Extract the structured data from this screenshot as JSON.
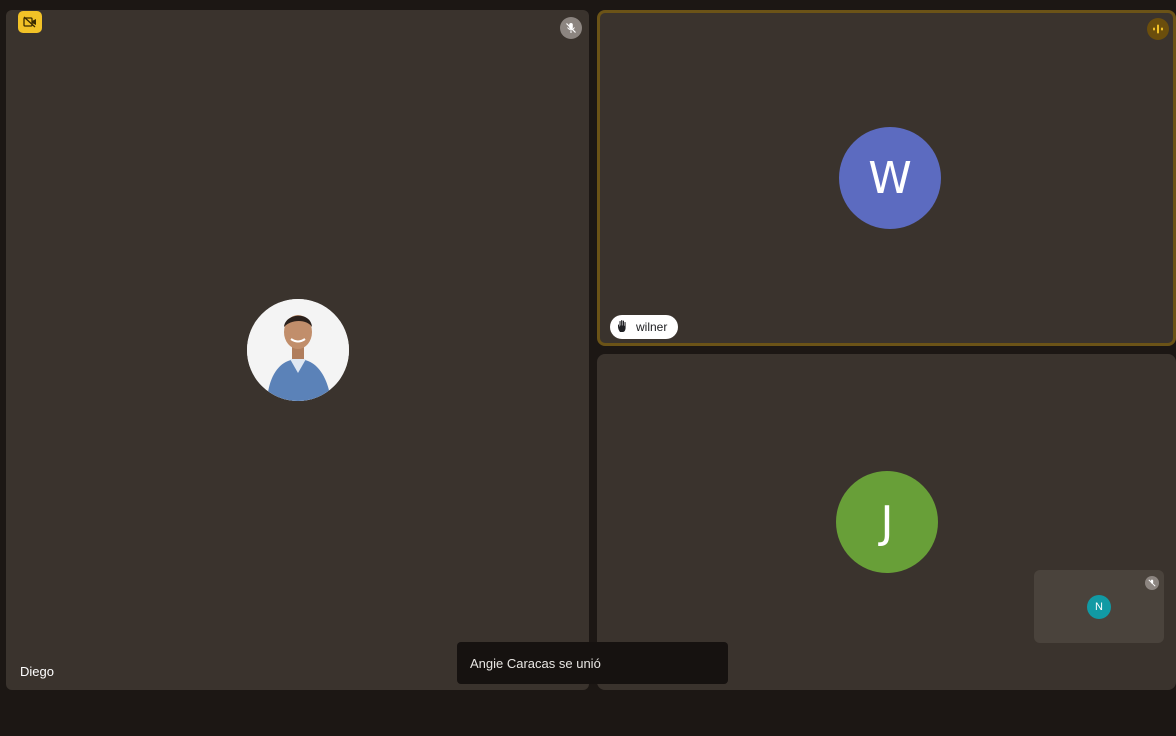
{
  "participants": {
    "diego": {
      "name": "Diego",
      "mic": "muted",
      "avatar": "photo"
    },
    "wilner": {
      "name": "wilner",
      "initial": "W",
      "avatar_color": "#5c6bc0",
      "hand_raised": true,
      "speaking": true
    },
    "j": {
      "initial": "J",
      "avatar_color": "#689f38"
    },
    "self_view": {
      "initial": "N",
      "avatar_color": "#119aa4",
      "mic": "muted"
    }
  },
  "notification": {
    "text": "Angie Caracas se unió"
  },
  "icons": {
    "camera_badge": "camera-off-icon",
    "mic_muted": "mic-off-icon",
    "speaking": "audio-indicator-icon",
    "hand": "raised-hand-icon"
  },
  "colors": {
    "tile_bg": "#3a332d",
    "page_bg": "#1c1714",
    "badge_yellow": "#f2c227",
    "speaking_border": "#6b5317"
  }
}
